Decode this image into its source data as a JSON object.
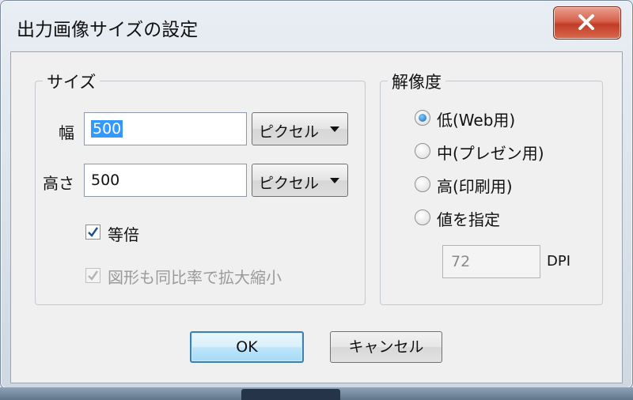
{
  "window": {
    "title": "出力画像サイズの設定"
  },
  "size_group": {
    "legend": "サイズ",
    "width": {
      "label": "幅",
      "value": "500",
      "unit": "ピクセル"
    },
    "height": {
      "label": "高さ",
      "value": "500",
      "unit": "ピクセル"
    },
    "keep_ratio": {
      "label": "等倍",
      "checked": true
    },
    "scale_shapes": {
      "label": "図形も同比率で拡大縮小",
      "checked": true,
      "enabled": false
    }
  },
  "resolution_group": {
    "legend": "解像度",
    "options": [
      {
        "label": "低(Web用)",
        "selected": true
      },
      {
        "label": "中(プレゼン用)",
        "selected": false
      },
      {
        "label": "高(印刷用)",
        "selected": false
      },
      {
        "label": "値を指定",
        "selected": false
      }
    ],
    "dpi_value": "72",
    "dpi_unit": "DPI"
  },
  "buttons": {
    "ok": "OK",
    "cancel": "キャンセル"
  },
  "colors": {
    "accent": "#3399ff",
    "close": "#c23c27",
    "default_border": "#3c7fb1"
  }
}
